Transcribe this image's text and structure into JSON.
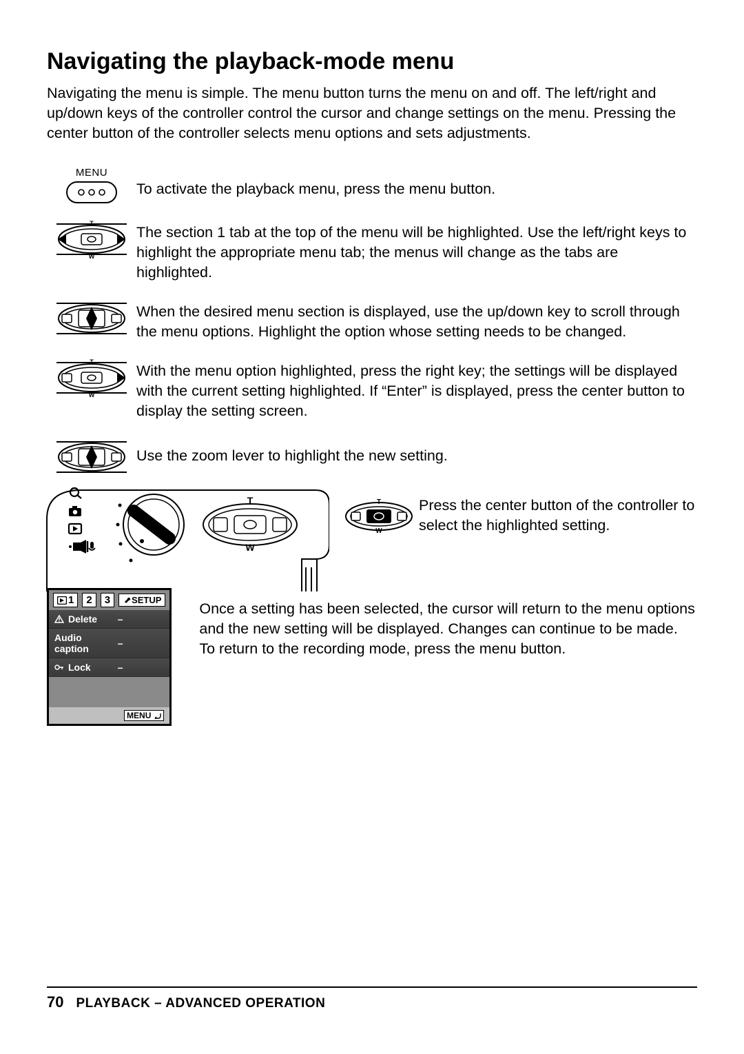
{
  "heading": "Navigating the playback-mode menu",
  "intro": "Navigating the menu is simple. The menu button turns the menu on and off. The left/right and up/down keys of the controller control the cursor and change settings on the menu. Pressing the center button of the controller selects menu options and sets adjustments.",
  "menu_label": "MENU",
  "steps": {
    "s1": "To activate the playback menu, press the menu button.",
    "s2": "The section 1 tab at the top of the menu will be highlighted. Use the left/right keys to highlight the appropriate menu tab; the menus will change as the tabs are highlighted.",
    "s3": "When the desired menu section is displayed, use the up/down key to scroll through the menu options. Highlight the option whose setting needs to be changed.",
    "s4": "With the menu option highlighted, press the right key; the settings will be displayed with the current setting highlighted. If “Enter” is displayed, press the center button to display the setting screen.",
    "s5": "Use the zoom lever to highlight the new setting."
  },
  "center_text": "Press the center button of the controller to select the highlighted setting.",
  "after_text": "Once a setting has been selected, the cursor will return to the menu options and the new setting will be displayed. Changes can continue to be made. To return to the recording mode, press the menu button.",
  "lcd": {
    "tabs": {
      "t1": "1",
      "t2": "2",
      "t3": "3",
      "setup": "SETUP"
    },
    "rows": {
      "r1": "Delete",
      "r2": "Audio caption",
      "r3": "Lock"
    },
    "dash": "–",
    "footer": "MENU"
  },
  "controller_marks": {
    "top": "T",
    "bottom": "W"
  },
  "footer": {
    "page": "70",
    "section": "PLAYBACK – ADVANCED OPERATION"
  }
}
